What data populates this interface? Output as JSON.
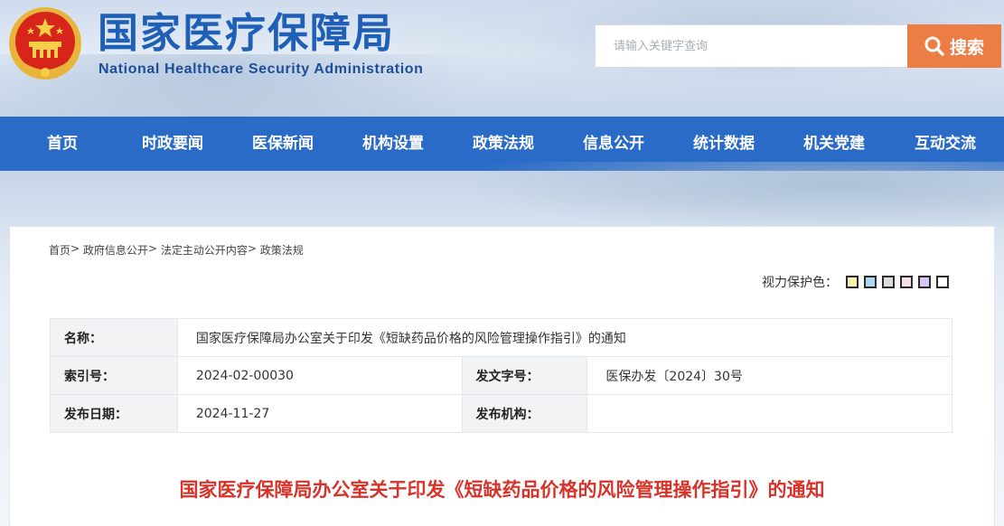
{
  "header": {
    "title_cn": "国家医疗保障局",
    "title_en": "National Healthcare Security Administration",
    "emblem_icon": "national-emblem-icon"
  },
  "search": {
    "placeholder": "请输入关键字查询",
    "button_label": "搜索",
    "button_color": "#ec7d45"
  },
  "nav": {
    "color": "#2a6bc7",
    "items": [
      {
        "label": "首页"
      },
      {
        "label": "时政要闻"
      },
      {
        "label": "医保新闻"
      },
      {
        "label": "机构设置"
      },
      {
        "label": "政策法规"
      },
      {
        "label": "信息公开"
      },
      {
        "label": "统计数据"
      },
      {
        "label": "机关党建"
      },
      {
        "label": "互动交流"
      }
    ]
  },
  "breadcrumb": {
    "items": [
      "首页",
      "政府信息公开",
      "法定主动公开内容",
      "政策法规"
    ],
    "separator": ">"
  },
  "eye_care": {
    "label": "视力保护色：",
    "colors": [
      "#f9f2b4",
      "#a8d8f0",
      "#dcdcdc",
      "#f3e1e6",
      "#d9c6f4",
      "#ffffff"
    ]
  },
  "info": {
    "name_label": "名称：",
    "name_value": "国家医疗保障局办公室关于印发《短缺药品价格的风险管理操作指引》的通知",
    "index_label": "索引号：",
    "index_value": "2024-02-00030",
    "docno_label": "发文字号：",
    "docno_value": "医保办发〔2024〕30号",
    "date_label": "发布日期：",
    "date_value": "2024-11-27",
    "issuer_label": "发布机构：",
    "issuer_value": ""
  },
  "document": {
    "title": "国家医疗保障局办公室关于印发《短缺药品价格的风险管理操作指引》的通知",
    "title_color": "#d8332a"
  }
}
